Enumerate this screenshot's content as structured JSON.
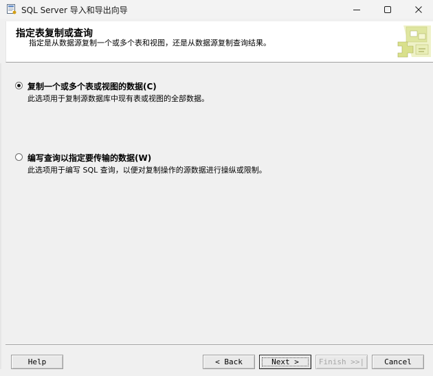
{
  "window": {
    "title": "SQL Server 导入和导出向导",
    "icon": "wizard-app-icon",
    "controls": {
      "minimize": "minimize-icon",
      "maximize": "maximize-icon",
      "close": "close-icon"
    }
  },
  "header": {
    "title": "指定表复制或查询",
    "subtitle": "指定是从数据源复制一个或多个表和视图，还是从数据源复制查询结果。",
    "graphic": "wizard-banner-graphic"
  },
  "options": [
    {
      "label": "复制一个或多个表或视图的数据(C)",
      "description": "此选项用于复制源数据库中现有表或视图的全部数据。",
      "selected": true
    },
    {
      "label": "编写查询以指定要传输的数据(W)",
      "description": "此选项用于编写 SQL 查询，以便对复制操作的源数据进行操纵或限制。",
      "selected": false
    }
  ],
  "buttons": {
    "help": "Help",
    "back": "< Back",
    "next": "Next >",
    "finish": "Finish >>|",
    "cancel": "Cancel"
  },
  "colors": {
    "background": "#f0f0f0",
    "banner": "#ffffff",
    "disabled_text": "#a6a6a6"
  }
}
